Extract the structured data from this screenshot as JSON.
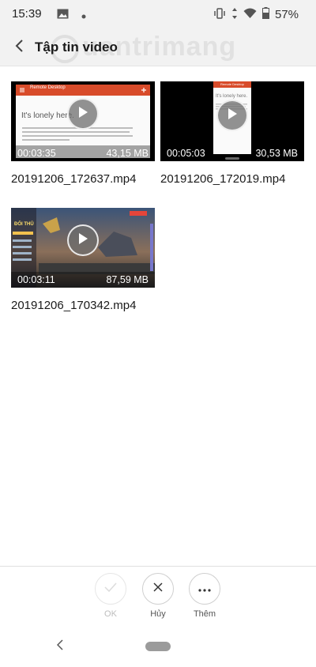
{
  "status_bar": {
    "time": "15:39",
    "battery": "57%"
  },
  "app_bar": {
    "title": "Tập tin video",
    "watermark": "uantrimang"
  },
  "videos": [
    {
      "duration": "00:03:35",
      "size": "43,15 MB",
      "name": "20191206_172637.mp4",
      "thumb": {
        "header": "Remote Desktop",
        "heading": "It's lonely here.",
        "body": "To get started, add the remote desktop that you want to connect to using this device. You can also add remote resources to work with apps and desktops your administrator has set up for you."
      }
    },
    {
      "duration": "00:05:03",
      "size": "30,53 MB",
      "name": "20191206_172019.mp4",
      "thumb": {
        "header": "Remote Desktop",
        "heading": "It's lonely here."
      }
    },
    {
      "duration": "00:03:11",
      "size": "87,59 MB",
      "name": "20191206_170342.mp4",
      "thumb": {
        "caption": "ĐỐI THỦ"
      }
    }
  ],
  "actions": [
    {
      "label": "OK",
      "icon": "check-icon",
      "enabled": false
    },
    {
      "label": "Hủy",
      "icon": "close-icon",
      "enabled": true
    },
    {
      "label": "Thêm",
      "icon": "more-icon",
      "enabled": true
    }
  ],
  "colors": {
    "accent_red": "#d84b2a",
    "status_bg": "#f2f2f2",
    "game_sky": "#2c3e5a"
  }
}
